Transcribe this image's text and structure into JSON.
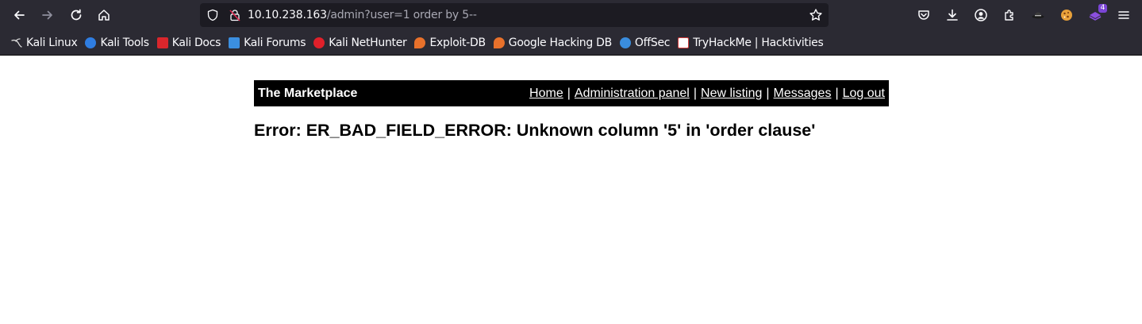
{
  "browser": {
    "url_host": "10.10.238.163",
    "url_path": "/admin?user=1 order by 5--",
    "extension_badge": "4",
    "bookmarks": [
      {
        "label": "Kali Linux",
        "icon": "kali-dragon-icon",
        "color": "#dddddd"
      },
      {
        "label": "Kali Tools",
        "icon": "kali-tools-icon",
        "color": "#2f7de1"
      },
      {
        "label": "Kali Docs",
        "icon": "kali-docs-icon",
        "color": "#d9262c"
      },
      {
        "label": "Kali Forums",
        "icon": "kali-forums-icon",
        "color": "#3b8fe0"
      },
      {
        "label": "Kali NetHunter",
        "icon": "nethunter-icon",
        "color": "#e0202a"
      },
      {
        "label": "Exploit-DB",
        "icon": "exploit-db-icon",
        "color": "#e8712b"
      },
      {
        "label": "Google Hacking DB",
        "icon": "ghdb-icon",
        "color": "#e8712b"
      },
      {
        "label": "OffSec",
        "icon": "offsec-icon",
        "color": "#3a8dde"
      },
      {
        "label": "TryHackMe | Hacktivities",
        "icon": "tryhackme-icon",
        "color": "#d23b3b"
      }
    ]
  },
  "header": {
    "brand": "The Marketplace",
    "nav": [
      "Home",
      "Administration panel",
      "New listing",
      "Messages",
      "Log out"
    ],
    "separator": "|"
  },
  "main": {
    "error": "Error: ER_BAD_FIELD_ERROR: Unknown column '5' in 'order clause'"
  }
}
